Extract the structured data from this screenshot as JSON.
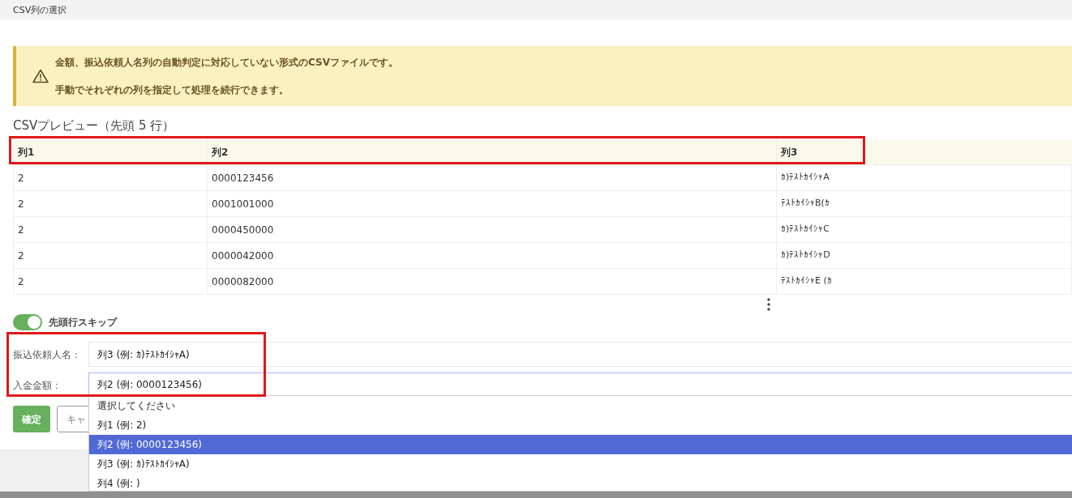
{
  "dialog_title": "CSV列の選択",
  "alert": {
    "lines": [
      "金額、振込依頼人名列の自動判定に対応していない形式のCSVファイルです。",
      "手動でそれぞれの列を指定して処理を続行できます。"
    ]
  },
  "preview": {
    "title": "CSVプレビュー（先頭 5 行）",
    "columns": [
      "列1",
      "列2",
      "列3"
    ],
    "rows": [
      [
        "2",
        "0000123456",
        "ｶ)ﾃｽﾄｶｲｼｬA"
      ],
      [
        "2",
        "0001001000",
        "ﾃｽﾄｶｲｼｬB(ｶ"
      ],
      [
        "2",
        "0000450000",
        "ｶ)ﾃｽﾄｶｲｼｬC"
      ],
      [
        "2",
        "0000042000",
        "ｶ)ﾃｽﾄｶｲｼｬD"
      ],
      [
        "2",
        "0000082000",
        "ﾃｽﾄｶｲｼｬE (ｶ"
      ]
    ]
  },
  "skip_header": {
    "label": "先頭行スキップ",
    "on": true
  },
  "fields": [
    {
      "label": "振込依頼人名：",
      "value": "列3 (例: ｶ)ﾃｽﾄｶｲｼｬA)",
      "focused": false
    },
    {
      "label": "入金金額：",
      "value": "列2 (例: 0000123456)",
      "focused": true
    }
  ],
  "dropdown": {
    "options": [
      {
        "label": "選択してください",
        "selected": false
      },
      {
        "label": "列1 (例: 2)",
        "selected": false
      },
      {
        "label": "列2 (例: 0000123456)",
        "selected": true
      },
      {
        "label": "列3 (例: ｶ)ﾃｽﾄｶｲｼｬA)",
        "selected": false
      },
      {
        "label": "列4 (例: )",
        "selected": false
      }
    ]
  },
  "buttons": [
    {
      "label": "確定",
      "kind": "primary"
    },
    {
      "label": "キャ",
      "kind": "secondary"
    }
  ]
}
